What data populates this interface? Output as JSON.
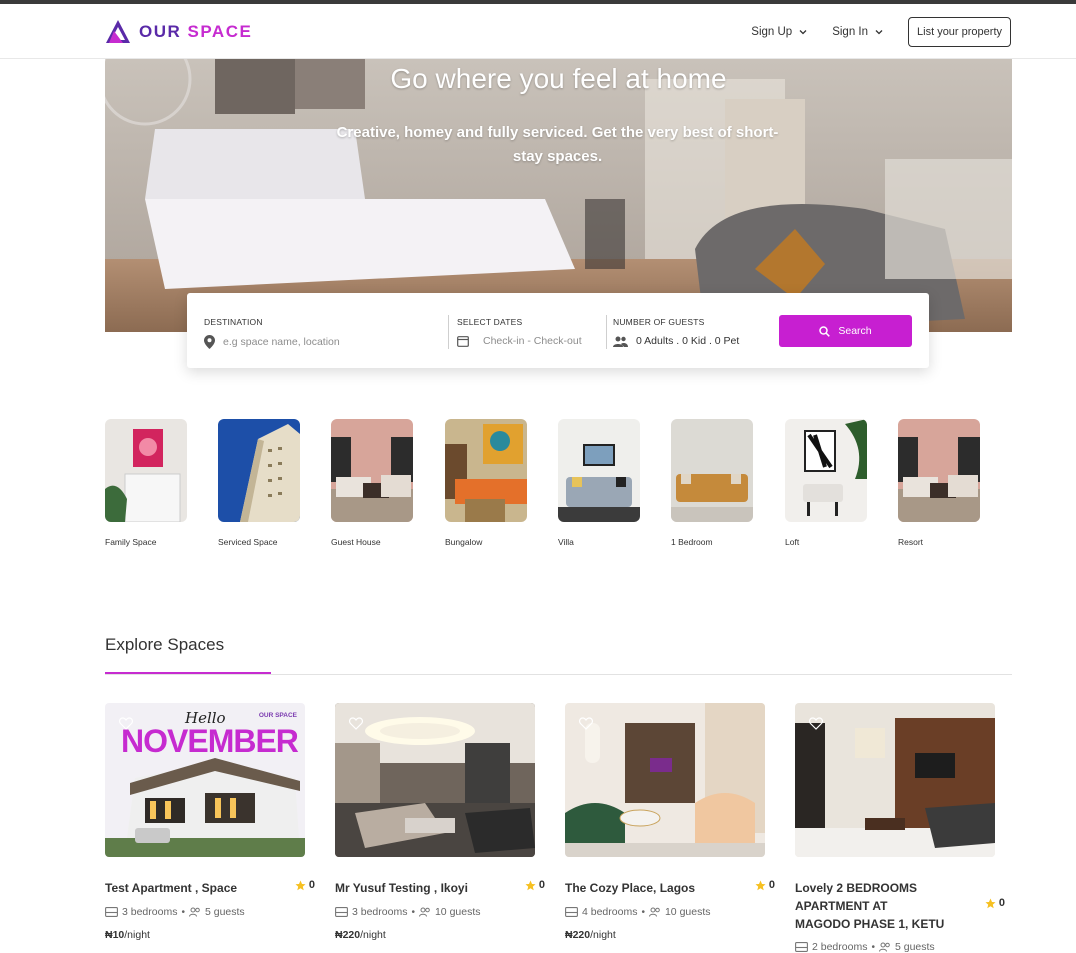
{
  "brand": {
    "name_a": "OUR ",
    "name_b": "SPACE"
  },
  "nav": {
    "sign_up": "Sign Up",
    "sign_in": "Sign In",
    "list_property": "List your property"
  },
  "hero": {
    "title": "Go where you feel at home",
    "subtitle": "Creative, homey and fully serviced. Get the very best of short-stay spaces."
  },
  "search": {
    "destination_label": "DESTINATION",
    "destination_placeholder": "e.g space name, location",
    "dates_label": "SELECT DATES",
    "dates_placeholder": "Check-in - Check-out",
    "guests_label": "NUMBER OF GUESTS",
    "guests_value": "0 Adults . 0 Kid . 0 Pet",
    "button": "Search",
    "accent": "#c71fd1"
  },
  "categories": [
    {
      "label": "Family Space"
    },
    {
      "label": "Serviced Space"
    },
    {
      "label": "Guest House"
    },
    {
      "label": "Bungalow"
    },
    {
      "label": "Villa"
    },
    {
      "label": "1 Bedroom"
    },
    {
      "label": "Loft"
    },
    {
      "label": "Resort"
    }
  ],
  "explore": {
    "title": "Explore Spaces",
    "cards": [
      {
        "title": "Test Apartment , Space",
        "rating": "0",
        "bedrooms": "3 bedrooms",
        "guests": "5 guests",
        "price": "₦10",
        "per": "/night",
        "image_text_a": "Hello",
        "image_text_b": "NOVEMBER",
        "image_logo": "OUR SPACE"
      },
      {
        "title": "Mr Yusuf Testing , Ikoyi",
        "rating": "0",
        "bedrooms": "3 bedrooms",
        "guests": "10 guests",
        "price": "₦220",
        "per": "/night"
      },
      {
        "title": "The Cozy Place, Lagos",
        "rating": "0",
        "bedrooms": "4 bedrooms",
        "guests": "10 guests",
        "price": "₦220",
        "per": "/night"
      },
      {
        "title": "Lovely 2 BEDROOMS APARTMENT AT MAGODO PHASE 1, KETU",
        "rating": "0",
        "bedrooms": "2 bedrooms",
        "guests": "5 guests",
        "price": "",
        "per": ""
      }
    ]
  }
}
